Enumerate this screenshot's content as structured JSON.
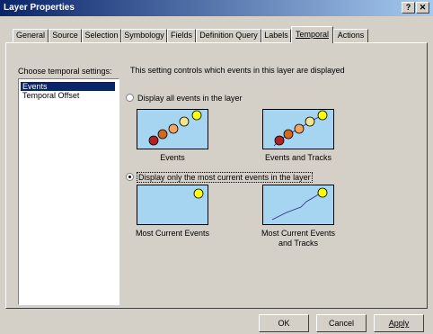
{
  "window": {
    "title": "Layer Properties",
    "help_label": "?",
    "close_label": "✕"
  },
  "tabs": [
    "General",
    "Source",
    "Selection",
    "Symbology",
    "Fields",
    "Definition Query",
    "Labels",
    "Temporal",
    "Actions"
  ],
  "active_tab": "Temporal",
  "settings": {
    "label": "Choose temporal settings:",
    "items": [
      "Events",
      "Temporal Offset"
    ],
    "selected": "Events"
  },
  "content": {
    "description": "This setting controls which events in this layer are displayed",
    "option_all": {
      "label": "Display all events in the layer",
      "selected": false
    },
    "option_current": {
      "label": "Display only the most current events in the layer",
      "selected": true
    },
    "thumbs": {
      "events": "Events",
      "events_tracks": "Events and Tracks",
      "most_current": "Most Current Events",
      "most_current_tracks_1": "Most Current Events",
      "most_current_tracks_2": "and Tracks"
    },
    "colors": {
      "thumb_bg": "#a6d5f1",
      "dot_dark": "#b22222",
      "dot_orange": "#d2691e",
      "dot_light": "#f4a460",
      "dot_pale": "#f5e58a",
      "dot_yellow": "#ffff00"
    }
  },
  "buttons": {
    "ok": "OK",
    "cancel": "Cancel",
    "apply": "Apply"
  }
}
